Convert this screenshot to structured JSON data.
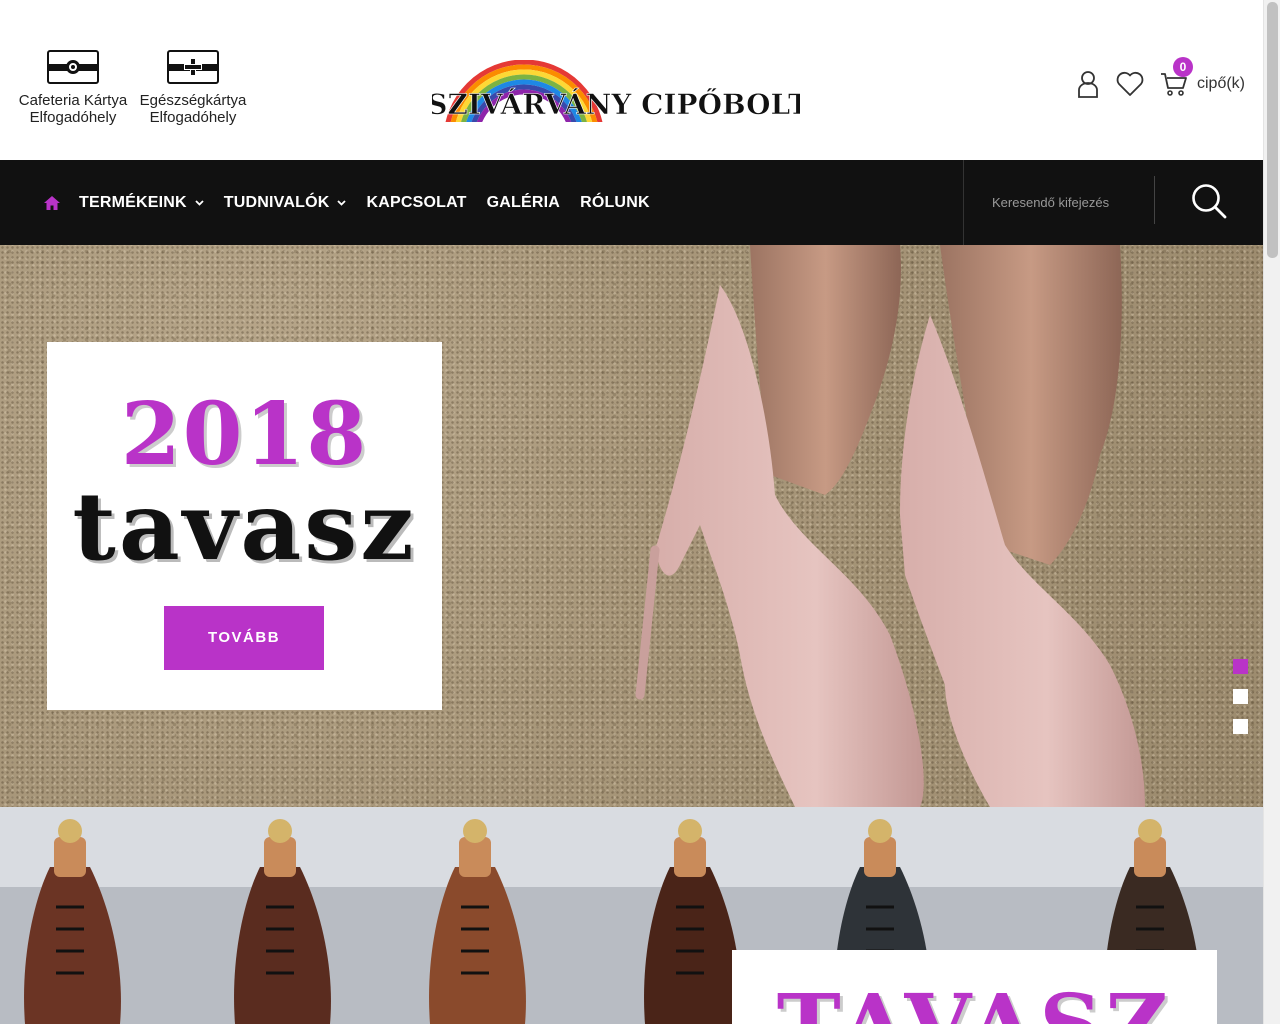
{
  "header": {
    "badges": [
      {
        "line1": "Cafeteria Kártya",
        "line2": "Elfogadóhely",
        "icon": "card-icon"
      },
      {
        "line1": "Egészségkártya",
        "line2": "Elfogadóhely",
        "icon": "health-card-icon"
      }
    ],
    "logo_text": "SZIVÁRVÁNY CIPŐBOLT",
    "cart_count": "0",
    "cart_label": "cipő(k)"
  },
  "nav": {
    "items": [
      {
        "label": "TERMÉKEINK",
        "has_dropdown": true
      },
      {
        "label": "TUDNIVALÓK",
        "has_dropdown": true
      },
      {
        "label": "KAPCSOLAT",
        "has_dropdown": false
      },
      {
        "label": "GALÉRIA",
        "has_dropdown": false
      },
      {
        "label": "RÓLUNK",
        "has_dropdown": false
      }
    ],
    "search_placeholder": "Keresendő kifejezés"
  },
  "hero": {
    "year": "2018",
    "season": "tavasz",
    "cta_label": "TOVÁBB",
    "slide_count": 3,
    "active_slide": 1
  },
  "hero2": {
    "season": "TAVASZ"
  },
  "colors": {
    "accent": "#b933c8",
    "nav_bg": "#111111",
    "text": "#222222"
  }
}
